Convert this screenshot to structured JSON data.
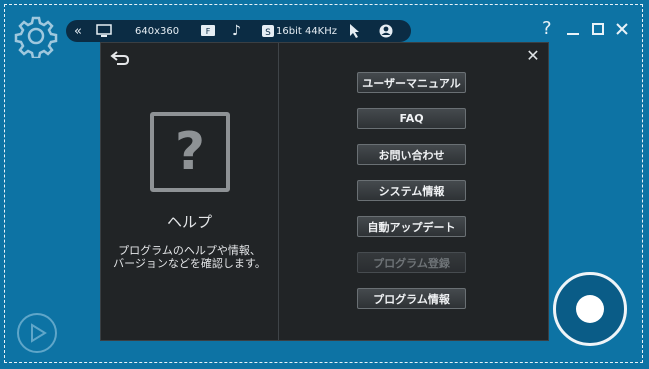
{
  "colors": {
    "background": "#0d73a4",
    "panel": "#212426",
    "status_bar": "#0b2c44",
    "record": "#0a5c87"
  },
  "status_bar": {
    "collapse_icon": "double-chevron-left-icon",
    "resolution": "640x360",
    "audio_format": "16bit 44KHz"
  },
  "window_controls": {
    "help": "?",
    "minimize": "minimize-icon",
    "maximize": "maximize-icon",
    "close": "close-icon"
  },
  "help_panel": {
    "title": "ヘルプ",
    "description_line1": "プログラムのヘルプや情報、",
    "description_line2": "バージョンなどを確認します。",
    "close_glyph": "✕",
    "help_glyph": "?",
    "menu": [
      {
        "label": "ユーザーマニュアル",
        "enabled": true
      },
      {
        "label": "FAQ",
        "enabled": true
      },
      {
        "label": "お問い合わせ",
        "enabled": true
      },
      {
        "label": "システム情報",
        "enabled": true
      },
      {
        "label": "自動アップデート",
        "enabled": true
      },
      {
        "label": "プログラム登録",
        "enabled": false
      },
      {
        "label": "プログラム情報",
        "enabled": true
      }
    ]
  }
}
